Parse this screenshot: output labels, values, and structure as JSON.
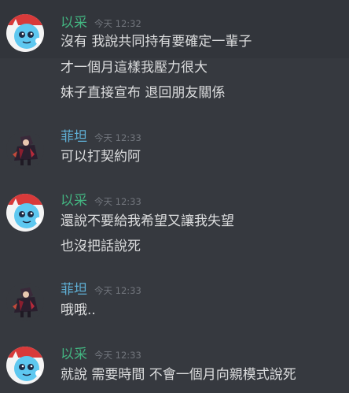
{
  "colors": {
    "background": "#36393f",
    "hover_background": "#32353b",
    "text": "#dcddde",
    "timestamp": "#72767d",
    "username_yicai": "#43b581",
    "username_feitan": "#5fb0d6"
  },
  "messages": [
    {
      "author": "以采",
      "timestamp": "今天 12:32",
      "avatar_icon": "blue-cartoon-avatar",
      "lines": [
        "沒有 我說共同持有要確定一輩子",
        "才一個月這樣我壓力很大",
        "妹子直接宣布 退回朋友關係"
      ]
    },
    {
      "author": "菲坦",
      "timestamp": "今天 12:33",
      "avatar_icon": "dark-character-avatar",
      "lines": [
        "可以打契約阿"
      ]
    },
    {
      "author": "以采",
      "timestamp": "今天 12:33",
      "avatar_icon": "blue-cartoon-avatar",
      "lines": [
        "還說不要給我希望又讓我失望",
        "也沒把話說死"
      ]
    },
    {
      "author": "菲坦",
      "timestamp": "今天 12:33",
      "avatar_icon": "dark-character-avatar",
      "lines": [
        "哦哦.."
      ]
    },
    {
      "author": "以采",
      "timestamp": "今天 12:33",
      "avatar_icon": "blue-cartoon-avatar",
      "lines": [
        "就說 需要時間 不會一個月向親模式說死"
      ]
    }
  ]
}
